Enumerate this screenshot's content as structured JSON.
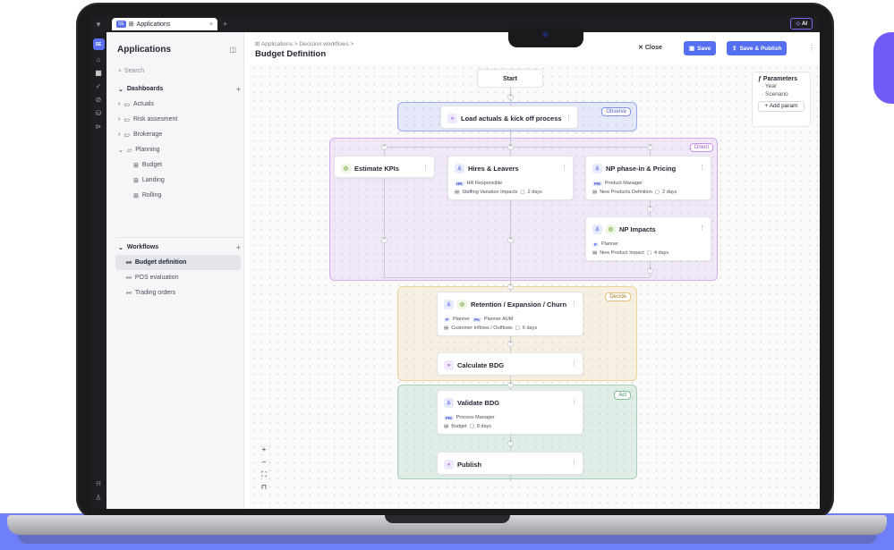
{
  "top_tab": {
    "badge": "SE",
    "icon": "grid-icon",
    "label": "Applications",
    "close": "×",
    "add": "+"
  },
  "ai_button": "AI",
  "rail": {
    "avatar": "SE"
  },
  "sidebar": {
    "title": "Applications",
    "search_placeholder": "Search",
    "dashboards": {
      "label": "Dashboards",
      "items": [
        {
          "label": "Actuals",
          "state": "collapsed"
        },
        {
          "label": "Risk assesment",
          "state": "collapsed"
        },
        {
          "label": "Brokerage",
          "state": "collapsed"
        },
        {
          "label": "Planning",
          "state": "expanded"
        }
      ],
      "planning_children": [
        "Budget",
        "Landing",
        "Rolling"
      ]
    },
    "workflows": {
      "label": "Workflows",
      "items": [
        "Budget definition",
        "POS evaluation",
        "Trading orders"
      ],
      "active": "Budget definition"
    }
  },
  "header": {
    "breadcrumb": "Applications  >  Decision workflows  >",
    "title": "Budget Definition",
    "close": "Close",
    "save": "Save",
    "save_publish": "Save & Publish"
  },
  "parameters": {
    "title": "Parameters",
    "items": [
      "Year",
      "Scenario"
    ],
    "add": "+ Add param"
  },
  "flow": {
    "start": "Start",
    "zones": {
      "observe": "Observe",
      "orient": "Orient",
      "decide": "Decide",
      "act": "Act"
    },
    "nodes": {
      "load": {
        "title": "Load actuals & kick off process"
      },
      "kpis": {
        "title": "Estimate KPIs"
      },
      "hires": {
        "title": "Hires & Leavers",
        "role_tag": "HR",
        "role": "HR Responsible",
        "resource": "Staffing Variation Impacts",
        "duration": "2 days"
      },
      "np_phase": {
        "title": "NP phase-in & Pricing",
        "role_tag": "PM",
        "role": "Product Manager",
        "resource": "New Products Definition",
        "duration": "2 days"
      },
      "np_impacts": {
        "title": "NP Impacts",
        "role_tag": "P",
        "role": "Planner",
        "resource": "New Product Impact",
        "duration": "4 days"
      },
      "retention": {
        "title": "Retention / Expansion / Churn",
        "role_tag": "P",
        "role": "Planner",
        "role_tag2": "PA",
        "role2": "Planner AUM",
        "resource": "Customer Inflows / Outflows",
        "duration": "6 days"
      },
      "calc": {
        "title": "Calculate BDG"
      },
      "validate": {
        "title": "Validate BDG",
        "role_tag": "PM",
        "role": "Process Manager",
        "resource": "Budget",
        "duration": "8 days"
      },
      "publish": {
        "title": "Publish"
      }
    }
  },
  "colors": {
    "accent": "#5470f0",
    "observe": "#9aa8f0",
    "orient": "#d5a9ee",
    "decide": "#ead49c",
    "act": "#a5cfb6"
  }
}
